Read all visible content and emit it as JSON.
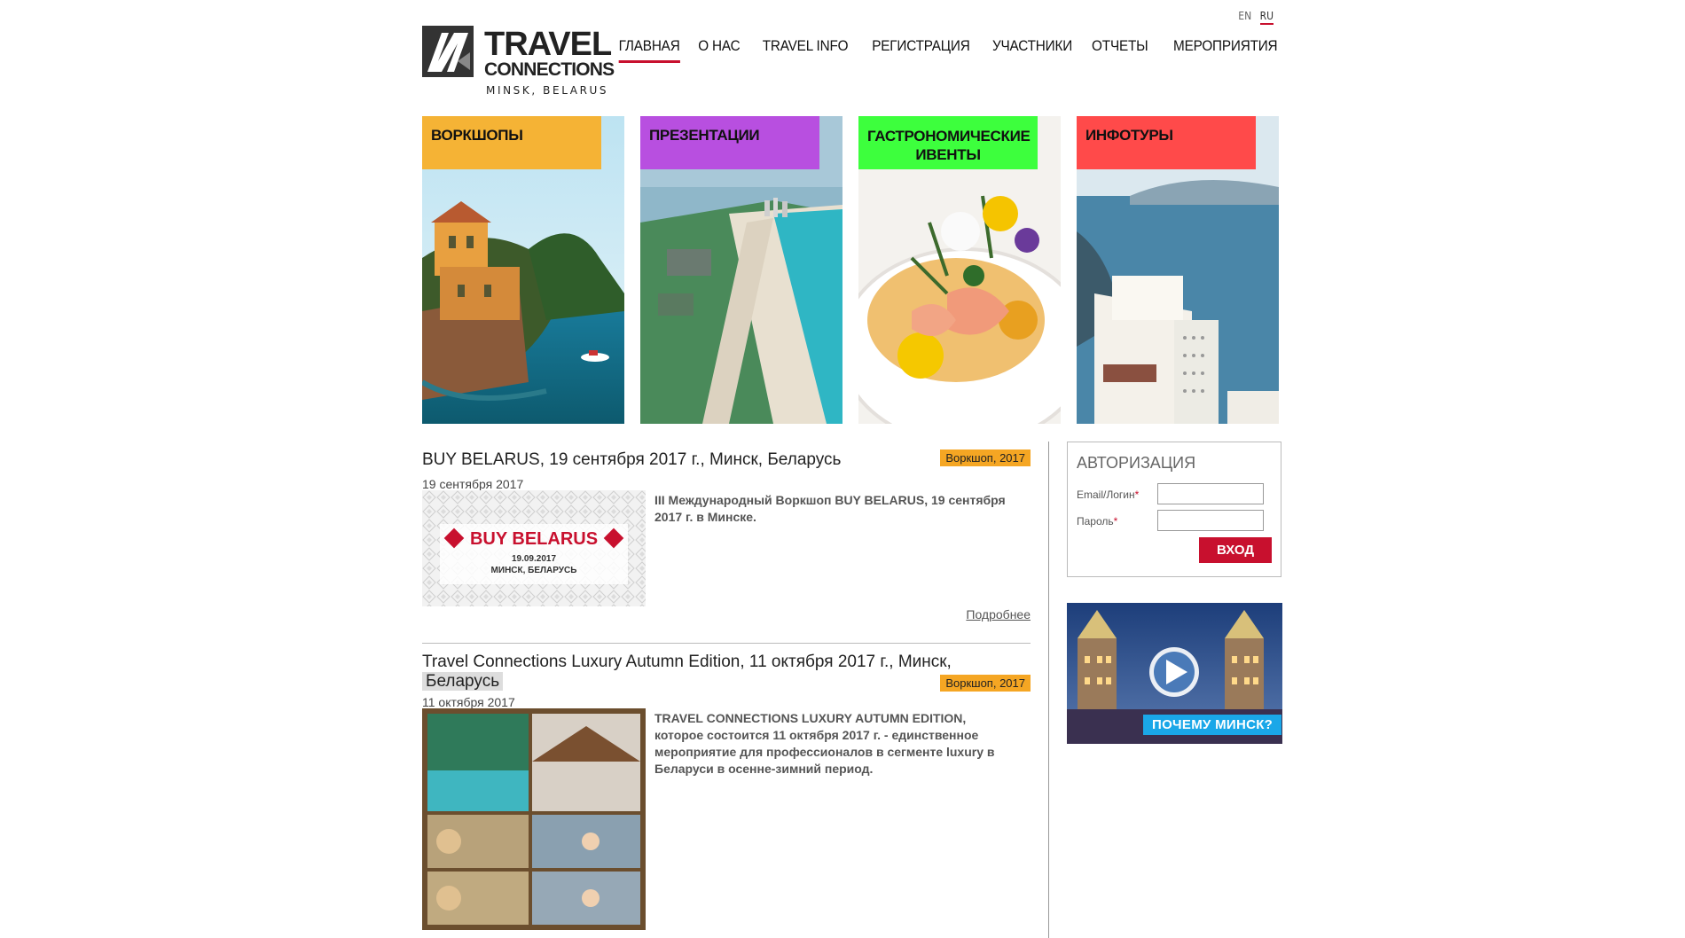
{
  "header": {
    "languages": [
      "EN",
      "RU"
    ],
    "active_language": "RU",
    "logo": {
      "brand_line1": "TRAVEL",
      "brand_line2": "CONNECTIONS",
      "location": "MINSK, BELARUS"
    },
    "nav": [
      "ГЛАВНАЯ",
      "О НАС",
      "TRAVEL INFO",
      "РЕГИСТРАЦИЯ",
      "УЧАСТНИКИ",
      "ОТЧЕТЫ",
      "МЕРОПРИЯТИЯ"
    ],
    "active_nav": "ГЛАВНАЯ"
  },
  "tiles": [
    {
      "label": "ВОРКШОПЫ",
      "color": "#f5b335"
    },
    {
      "label": "ПРЕЗЕНТАЦИИ",
      "color": "#b84fe0"
    },
    {
      "label": "ГАСТРОНОМИЧЕСКИЕ ИВЕНТЫ",
      "color": "#3dff3d"
    },
    {
      "label": "ИНФОТУРЫ",
      "color": "#ff4a4a"
    }
  ],
  "articles": [
    {
      "title": "BUY BELARUS, 19 сентября 2017 г., Минск, Беларусь",
      "badge": "Воркшоп, 2017",
      "date": "19 сентября 2017",
      "text": "III Международный Воркшоп BUY BELARUS, 19 сентября 2017 г. в Минске.",
      "image": {
        "headline": "BUY BELARUS",
        "date": "19.09.2017",
        "place": "МИНСК, БЕЛАРУСЬ"
      },
      "more": "Подробнее"
    },
    {
      "title": "Travel Connections Luxury Autumn Edition, 11 октября 2017 г., Минск,",
      "title_highlight": "Беларусь",
      "badge": "Воркшоп, 2017",
      "date": "11 октября 2017",
      "text": "TRAVEL CONNECTIONS LUXURY AUTUMN EDITION, которое состоится 11 октября 2017 г. - единственное мероприятие для профессионалов в сегменте luxury в Беларуси в осенне-зимний период."
    }
  ],
  "auth": {
    "title": "АВТОРИЗАЦИЯ",
    "email_label": "Email/Логин",
    "password_label": "Пароль",
    "required_mark": "*",
    "submit": "ВХОД"
  },
  "promo": {
    "caption": "ПОЧЕМУ МИНСК?"
  },
  "colors": {
    "accent": "#c8102e",
    "badge": "#f5a623",
    "promo": "#1aa7e8"
  }
}
